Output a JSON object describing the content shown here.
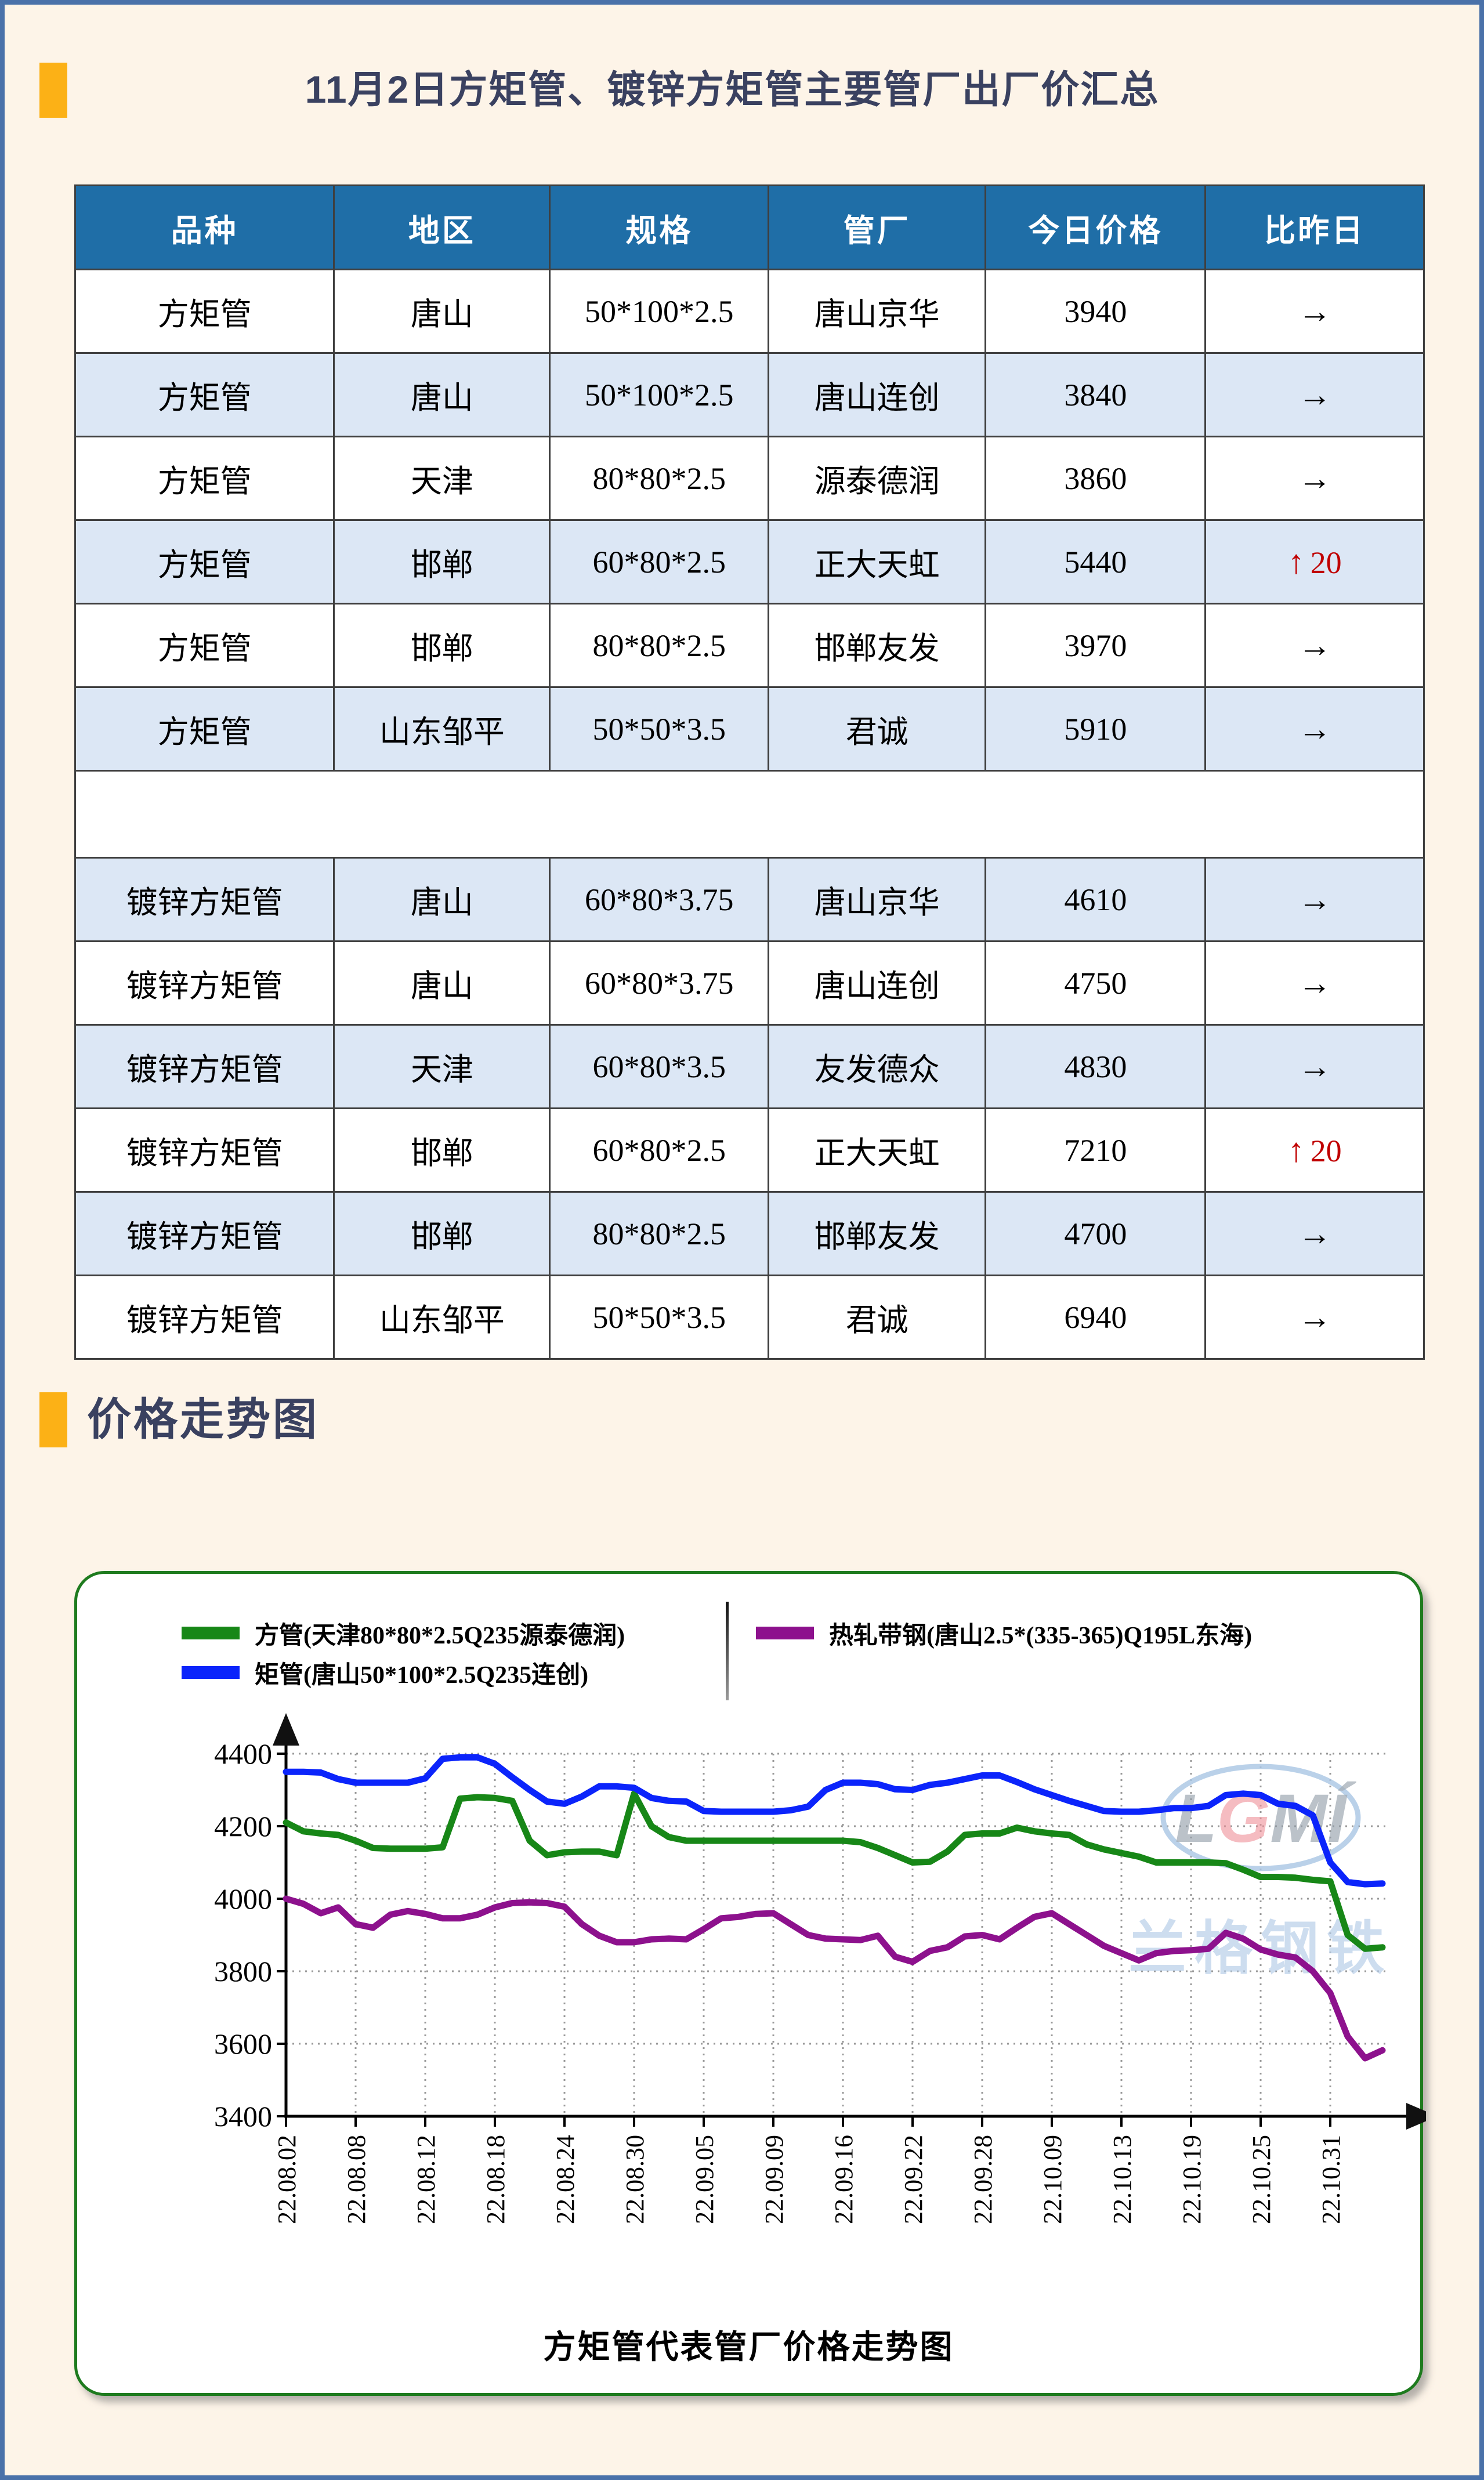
{
  "page": {
    "title": "11月2日方矩管、镀锌方矩管主要管厂出厂价汇总",
    "trend_section_title": "价格走势图"
  },
  "price_table": {
    "headers": [
      "品种",
      "地区",
      "规格",
      "管厂",
      "今日价格",
      "比昨日"
    ],
    "flat_symbol": "→",
    "up_symbol": "↑",
    "groups": [
      {
        "rows": [
          {
            "variety": "方矩管",
            "region": "唐山",
            "spec": "50*100*2.5",
            "factory": "唐山京华",
            "price": "3940",
            "change": {
              "dir": "flat"
            }
          },
          {
            "variety": "方矩管",
            "region": "唐山",
            "spec": "50*100*2.5",
            "factory": "唐山连创",
            "price": "3840",
            "change": {
              "dir": "flat"
            }
          },
          {
            "variety": "方矩管",
            "region": "天津",
            "spec": "80*80*2.5",
            "factory": "源泰德润",
            "price": "3860",
            "change": {
              "dir": "flat"
            }
          },
          {
            "variety": "方矩管",
            "region": "邯郸",
            "spec": "60*80*2.5",
            "factory": "正大天虹",
            "price": "5440",
            "change": {
              "dir": "up",
              "value": "20"
            }
          },
          {
            "variety": "方矩管",
            "region": "邯郸",
            "spec": "80*80*2.5",
            "factory": "邯郸友发",
            "price": "3970",
            "change": {
              "dir": "flat"
            }
          },
          {
            "variety": "方矩管",
            "region": "山东邹平",
            "spec": "50*50*3.5",
            "factory": "君诚",
            "price": "5910",
            "change": {
              "dir": "flat"
            }
          }
        ]
      },
      {
        "rows": [
          {
            "variety": "镀锌方矩管",
            "region": "唐山",
            "spec": "60*80*3.75",
            "factory": "唐山京华",
            "price": "4610",
            "change": {
              "dir": "flat"
            }
          },
          {
            "variety": "镀锌方矩管",
            "region": "唐山",
            "spec": "60*80*3.75",
            "factory": "唐山连创",
            "price": "4750",
            "change": {
              "dir": "flat"
            }
          },
          {
            "variety": "镀锌方矩管",
            "region": "天津",
            "spec": "60*80*3.5",
            "factory": "友发德众",
            "price": "4830",
            "change": {
              "dir": "flat"
            }
          },
          {
            "variety": "镀锌方矩管",
            "region": "邯郸",
            "spec": "60*80*2.5",
            "factory": "正大天虹",
            "price": "7210",
            "change": {
              "dir": "up",
              "value": "20"
            }
          },
          {
            "variety": "镀锌方矩管",
            "region": "邯郸",
            "spec": "80*80*2.5",
            "factory": "邯郸友发",
            "price": "4700",
            "change": {
              "dir": "flat"
            }
          },
          {
            "variety": "镀锌方矩管",
            "region": "山东邹平",
            "spec": "50*50*3.5",
            "factory": "君诚",
            "price": "6940",
            "change": {
              "dir": "flat"
            }
          }
        ]
      }
    ]
  },
  "chart_data": {
    "type": "line",
    "title": "方矩管代表管厂价格走势图",
    "xlabel": "",
    "ylabel": "",
    "ylim": [
      3400,
      4400
    ],
    "y_ticks": [
      3400,
      3600,
      3800,
      4000,
      4200,
      4400
    ],
    "grid": true,
    "legend_position": "top",
    "tick_label_rotation": "vertical",
    "x_tick_labels": [
      "22.08.02",
      "22.08.08",
      "22.08.12",
      "22.08.18",
      "22.08.24",
      "22.08.30",
      "22.09.05",
      "22.09.09",
      "22.09.16",
      "22.09.22",
      "22.09.28",
      "22.10.09",
      "22.10.13",
      "22.10.19",
      "22.10.25",
      "22.10.31"
    ],
    "series": [
      {
        "name": "方管(天津80*80*2.5Q235源泰德润)",
        "color": "#178717",
        "values": [
          4210,
          4186,
          4180,
          4176,
          4160,
          4140,
          4138,
          4138,
          4138,
          4142,
          4276,
          4280,
          4278,
          4270,
          4160,
          4120,
          4128,
          4130,
          4130,
          4120,
          4290,
          4200,
          4170,
          4160,
          4160,
          4160,
          4160,
          4160,
          4160,
          4160,
          4160,
          4160,
          4160,
          4156,
          4140,
          4120,
          4100,
          4102,
          4130,
          4176,
          4180,
          4180,
          4196,
          4186,
          4180,
          4176,
          4150,
          4136,
          4126,
          4116,
          4100,
          4100,
          4100,
          4100,
          4098,
          4080,
          4060,
          4060,
          4058,
          4052,
          4048,
          3900,
          3862,
          3866
        ]
      },
      {
        "name": "矩管(唐山50*100*2.5Q235连创)",
        "color": "#0b24fb",
        "values": [
          4350,
          4350,
          4348,
          4330,
          4320,
          4320,
          4320,
          4320,
          4332,
          4386,
          4390,
          4390,
          4372,
          4335,
          4300,
          4268,
          4262,
          4282,
          4310,
          4310,
          4306,
          4278,
          4270,
          4268,
          4242,
          4240,
          4240,
          4240,
          4240,
          4244,
          4254,
          4300,
          4320,
          4320,
          4316,
          4302,
          4300,
          4314,
          4320,
          4330,
          4340,
          4340,
          4322,
          4302,
          4286,
          4270,
          4256,
          4242,
          4240,
          4240,
          4244,
          4250,
          4250,
          4256,
          4286,
          4290,
          4286,
          4262,
          4256,
          4230,
          4100,
          4046,
          4040,
          4042
        ]
      },
      {
        "name": "热轧带钢(唐山2.5*(335-365)Q195L东海)",
        "color": "#8d118d",
        "values": [
          4000,
          3986,
          3960,
          3976,
          3930,
          3920,
          3956,
          3966,
          3958,
          3946,
          3946,
          3956,
          3976,
          3988,
          3990,
          3988,
          3978,
          3930,
          3898,
          3880,
          3880,
          3888,
          3890,
          3888,
          3916,
          3946,
          3950,
          3958,
          3960,
          3930,
          3900,
          3890,
          3888,
          3886,
          3898,
          3840,
          3826,
          3856,
          3866,
          3896,
          3900,
          3888,
          3920,
          3950,
          3960,
          3930,
          3900,
          3870,
          3850,
          3830,
          3850,
          3856,
          3858,
          3862,
          3906,
          3890,
          3860,
          3846,
          3838,
          3800,
          3740,
          3620,
          3560,
          3582
        ]
      }
    ],
    "watermark": {
      "logo_text": "LGMI",
      "sub_text": "兰格钢铁"
    }
  },
  "colors": {
    "frame": "#4a71a9",
    "background": "#fdf4e8",
    "accent_orange": "#fcb116",
    "title_navy": "#3a4160",
    "header_bg": "#1f6ea7",
    "header_text": "#ffffff",
    "row_alt": "#dce7f5",
    "table_border": "#3f3f3f",
    "up_red": "#c00000",
    "card_border": "#1e7b1e",
    "gridline": "#999999"
  }
}
